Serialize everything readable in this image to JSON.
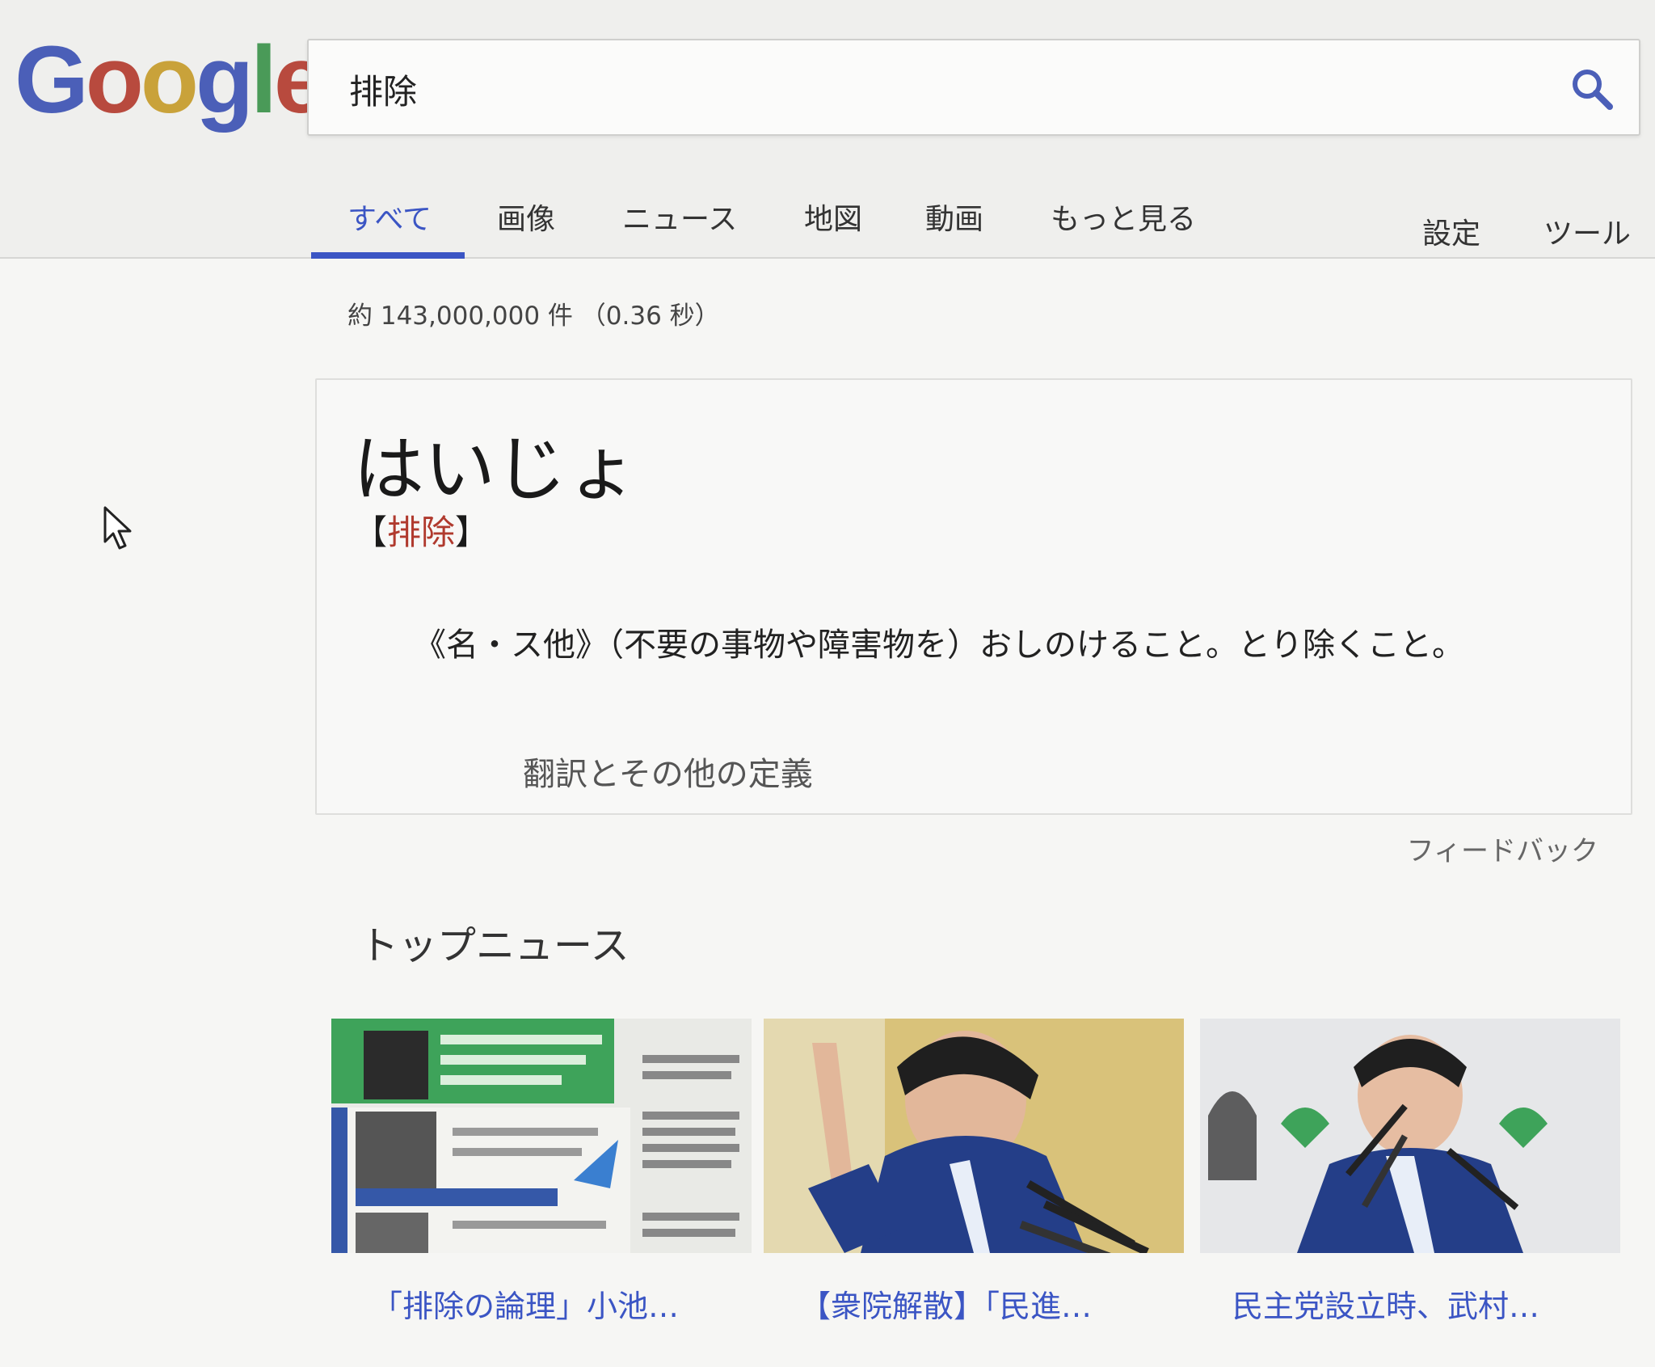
{
  "logo": {
    "text": "Google"
  },
  "search": {
    "query": "排除"
  },
  "tabs": [
    {
      "label": "すべて",
      "active": true
    },
    {
      "label": "画像"
    },
    {
      "label": "ニュース"
    },
    {
      "label": "地図"
    },
    {
      "label": "動画"
    },
    {
      "label": "もっと見る"
    }
  ],
  "tools": {
    "settings": "設定",
    "tools": "ツール"
  },
  "result_stats": "約 143,000,000 件 （0.36 秒）",
  "dictionary": {
    "reading": "はいじょ",
    "bracket_open": "【",
    "kanji": "排除",
    "bracket_close": "】",
    "definition": "《名・ス他》（不要の事物や障害物を）おしのけること。とり除くこと。",
    "more_link": "翻訳とその他の定義"
  },
  "feedback": "フィードバック",
  "top_news": {
    "title": "トップニュース",
    "items": [
      {
        "headline": "「排除の論理」小池…"
      },
      {
        "headline": "【衆院解散】「民進…"
      },
      {
        "headline": "民主党設立時、武村…"
      }
    ]
  },
  "colors": {
    "accent": "#3b55c4",
    "kanji": "#b03a2e"
  }
}
